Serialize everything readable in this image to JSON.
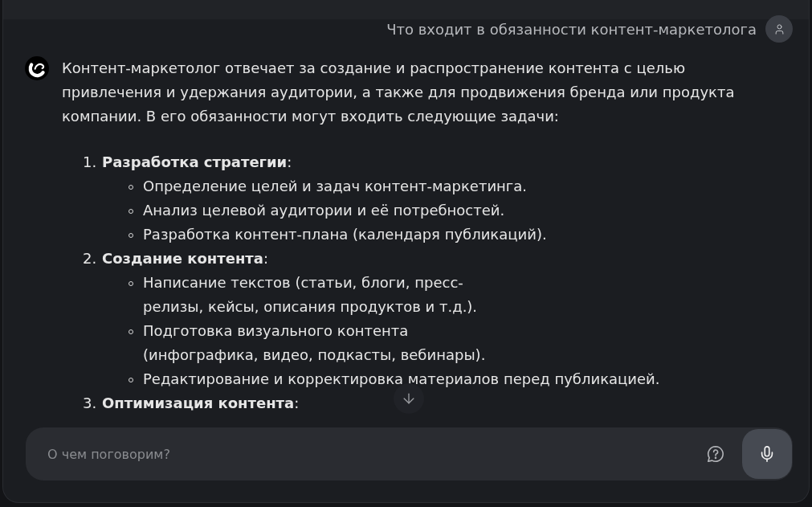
{
  "user_message": {
    "text": "Что входит в обязанности контент-маркетолога"
  },
  "assistant_message": {
    "intro": "Контент-маркетолог отвечает за создание и распространение контента с целью привлечения и удержания аудитории, а также для продвижения бренда или продукта компании. В его обязанности могут входить следующие задачи:",
    "items": [
      {
        "number": "1.",
        "title": "**Разработка стратегии**:",
        "children": [
          {
            "lines": [
              "Определение целей и задач контент-маркетинга."
            ]
          },
          {
            "lines": [
              "Анализ целевой аудитории и её потребностей."
            ]
          },
          {
            "lines": [
              "Разработка контент-плана (календаря публикаций)."
            ]
          }
        ]
      },
      {
        "number": "2.",
        "title": "**Создание контента**:",
        "children": [
          {
            "lines": [
              "Написание текстов (статьи, блоги, пресс-",
              "релизы, кейсы, описания продуктов и т.д.)."
            ]
          },
          {
            "lines": [
              "Подготовка визуального контента",
              "(инфографика, видео, подкасты, вебинары)."
            ]
          },
          {
            "lines": [
              "Редактирование и корректировка материалов перед публикацией."
            ]
          }
        ]
      },
      {
        "number": "3.",
        "title": "**Оптимизация контента**:"
      }
    ]
  },
  "composer": {
    "placeholder": "О чем поговорим?"
  }
}
